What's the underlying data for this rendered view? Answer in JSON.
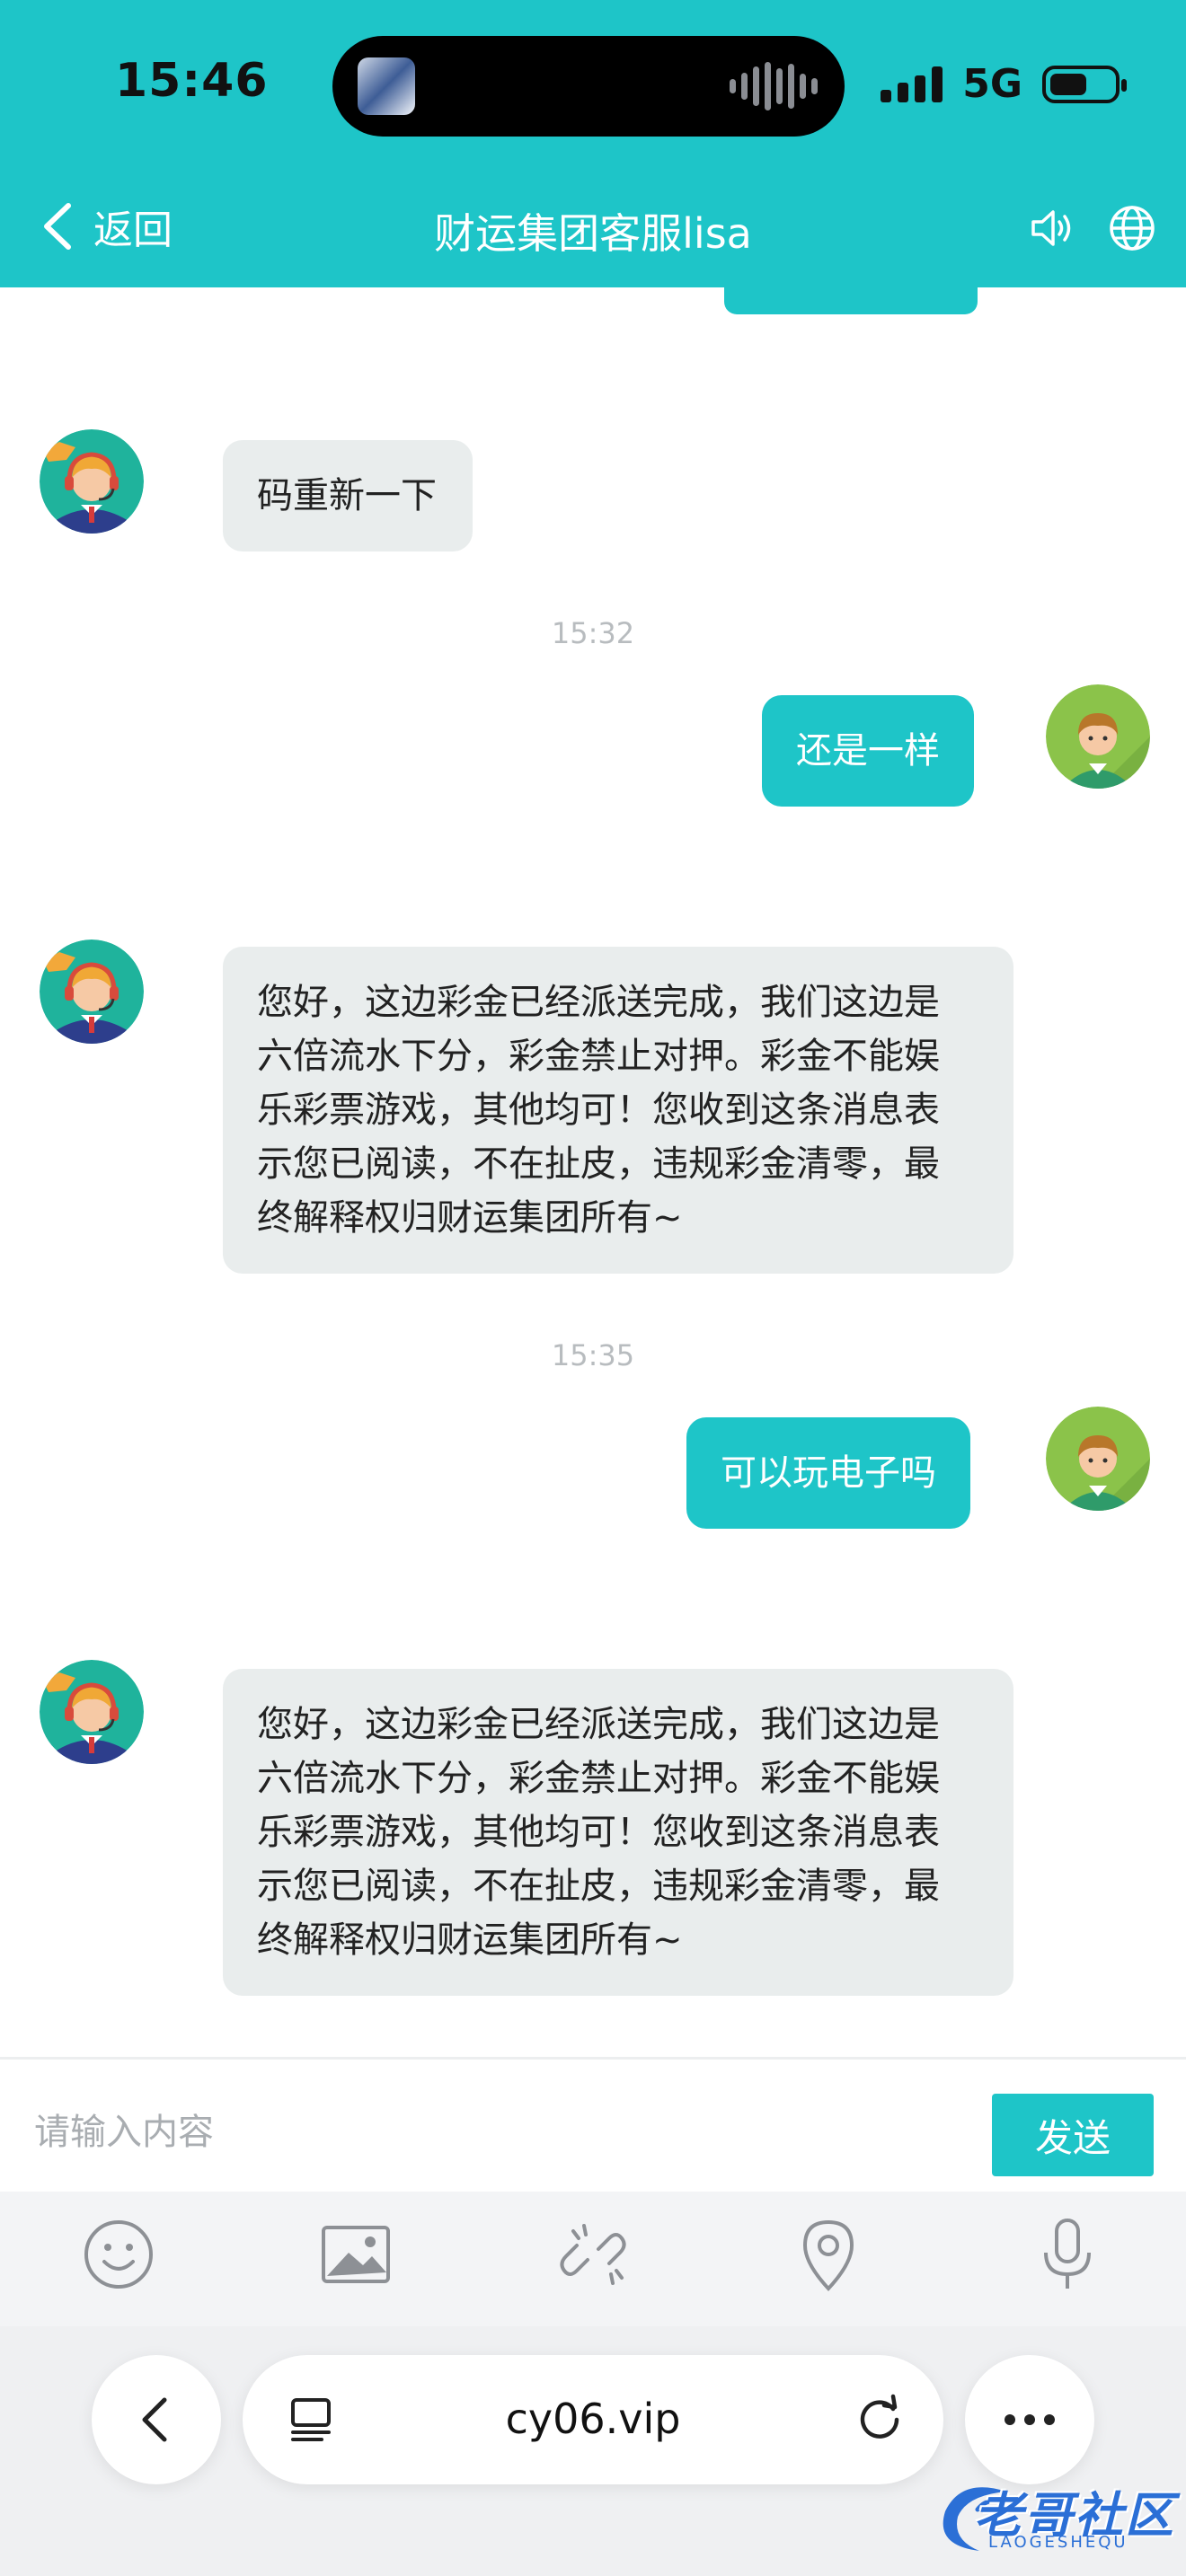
{
  "status_bar": {
    "time": "15:46",
    "network": "5G"
  },
  "header": {
    "back_label": "返回",
    "title": "财运集团客服lisa"
  },
  "messages": [
    {
      "side": "in",
      "text": "码重新一下"
    },
    {
      "side": "out",
      "text": "还是一样",
      "time": "15:32"
    },
    {
      "side": "in",
      "lines": [
        "您好，这边彩金已经派送完成，我们这边是",
        "六倍流水下分，彩金禁止对押。彩金不能娱",
        "乐彩票游戏，其他均可！您收到这条消息表",
        "示您已阅读，不在扯皮，违规彩金清零，最",
        "终解释权归财运集团所有~"
      ]
    },
    {
      "side": "out",
      "text": "可以玩电子吗",
      "time": "15:35"
    },
    {
      "side": "in",
      "lines": [
        "您好，这边彩金已经派送完成，我们这边是",
        "六倍流水下分，彩金禁止对押。彩金不能娱",
        "乐彩票游戏，其他均可！您收到这条消息表",
        "示您已阅读，不在扯皮，违规彩金清零，最",
        "终解释权归财运集团所有~"
      ]
    }
  ],
  "input": {
    "placeholder": "请输入内容",
    "send_label": "发送"
  },
  "tools": [
    "emoji-icon",
    "image-icon",
    "link-icon",
    "location-icon",
    "microphone-icon"
  ],
  "browser": {
    "url": "cy06.vip"
  },
  "watermark": {
    "text": "老哥社区",
    "sub": "LAOGESHEQU"
  },
  "colors": {
    "accent": "#1ec5c8",
    "incoming_bubble": "#e9eded",
    "timestamp": "#b8bcbf"
  }
}
